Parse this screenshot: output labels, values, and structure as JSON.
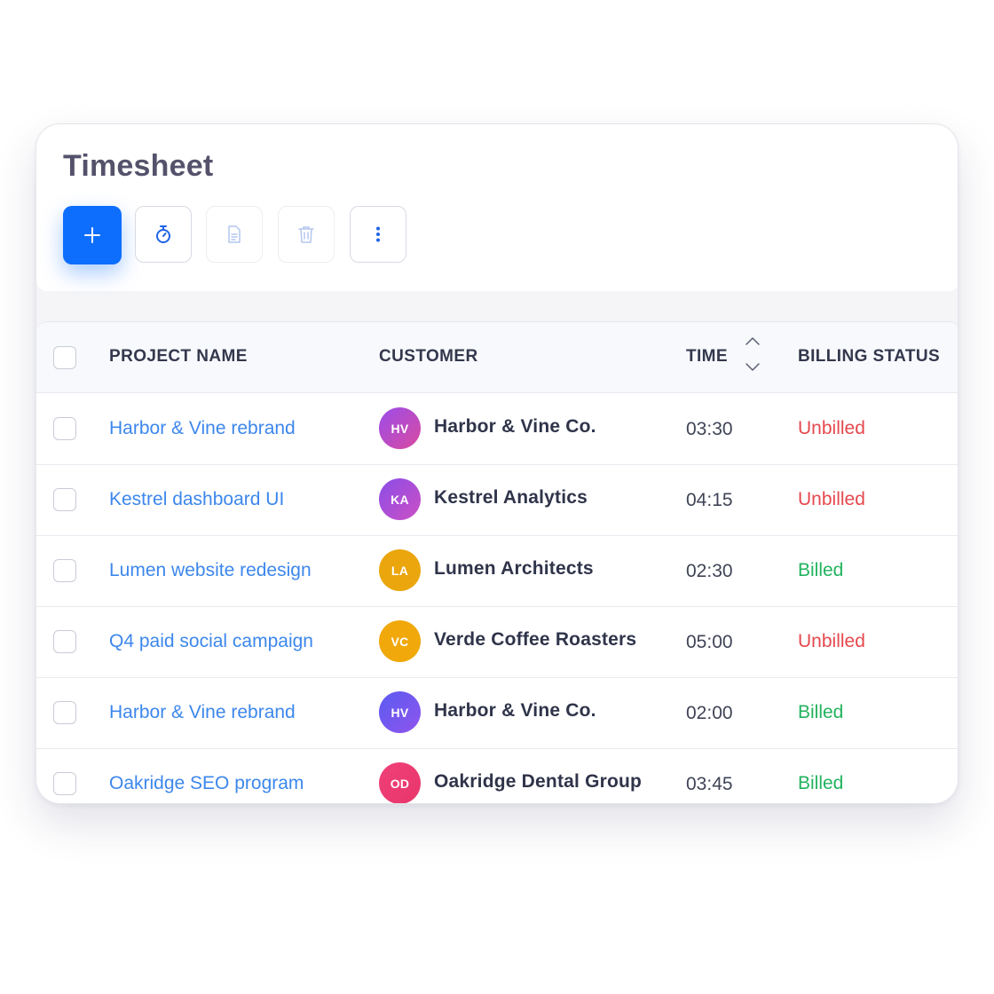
{
  "page": {
    "title": "Timesheet"
  },
  "toolbar": {
    "add": {
      "icon": "plus-icon",
      "label": "+"
    },
    "timer": {
      "icon": "stopwatch-icon"
    },
    "document": {
      "icon": "document-icon"
    },
    "delete": {
      "icon": "trash-icon"
    },
    "more": {
      "icon": "more-vertical-icon"
    }
  },
  "colors": {
    "accent": "#0d6efd",
    "link": "#3c87ec",
    "unbilled": "#e5484d",
    "billed": "#22b35e"
  },
  "table": {
    "columns": {
      "project": "PROJECT NAME",
      "customer": "CUSTOMER",
      "time": "TIME",
      "billing": "BILLING STATUS"
    },
    "rows": [
      {
        "project": "Harbor & Vine rebrand",
        "initials": "HV",
        "customer": "Harbor & Vine Co.",
        "time": "03:30",
        "status": "Unbilled",
        "status_type": "unbilled",
        "avatar_color": "linear-gradient(135deg,#9b4dea,#d94aa0)"
      },
      {
        "project": "Kestrel dashboard UI",
        "initials": "KA",
        "customer": "Kestrel Analytics",
        "time": "04:15",
        "status": "Unbilled",
        "status_type": "unbilled",
        "avatar_color": "linear-gradient(135deg,#8b4ee8,#cc4fc4)"
      },
      {
        "project": "Lumen website redesign",
        "initials": "LA",
        "customer": "Lumen Architects",
        "time": "02:30",
        "status": "Billed",
        "status_type": "billed",
        "avatar_color": "#eaa60c"
      },
      {
        "project": "Q4 paid social campaign",
        "initials": "VC",
        "customer": "Verde Coffee Roasters",
        "time": "05:00",
        "status": "Unbilled",
        "status_type": "unbilled",
        "avatar_color": "#f0a80a"
      },
      {
        "project": "Harbor & Vine rebrand",
        "initials": "HV",
        "customer": "Harbor & Vine Co.",
        "time": "02:00",
        "status": "Billed",
        "status_type": "billed",
        "avatar_color": "linear-gradient(135deg,#5b5bf0,#8f55ee)"
      },
      {
        "project": "Oakridge SEO program",
        "initials": "OD",
        "customer": "Oakridge Dental Group",
        "time": "03:45",
        "status": "Billed",
        "status_type": "billed",
        "avatar_color": "linear-gradient(135deg,#f0407a,#e8366a)"
      }
    ]
  }
}
